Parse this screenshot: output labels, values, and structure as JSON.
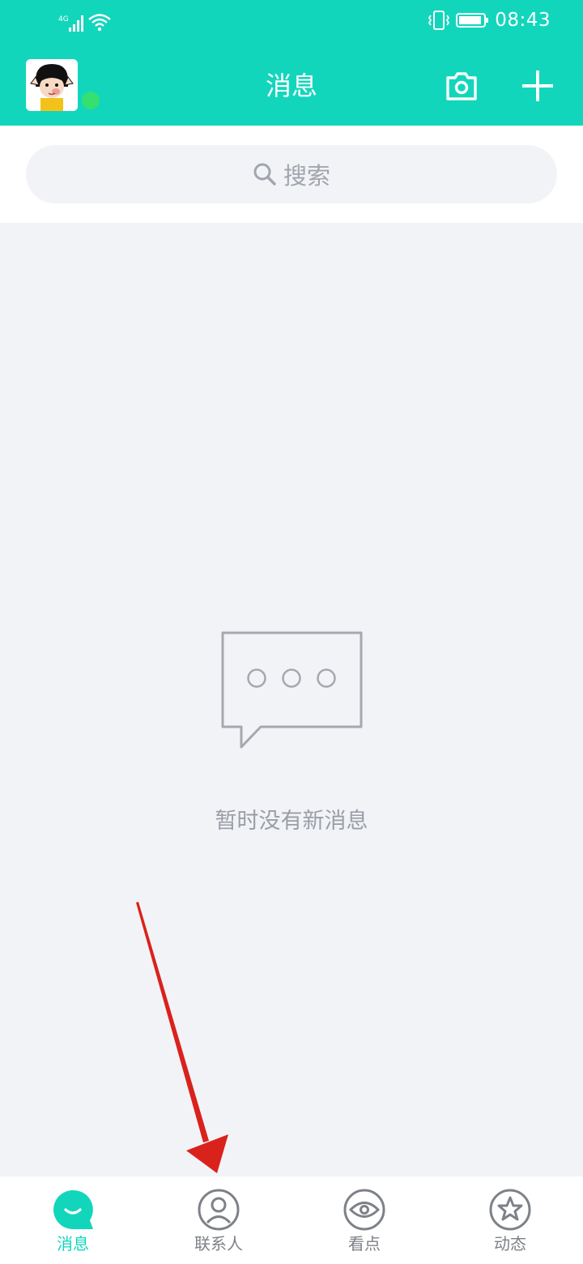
{
  "status_bar": {
    "network": "4G",
    "time": "08:43"
  },
  "header": {
    "title": "消息",
    "icons": [
      "avatar",
      "camera-icon",
      "plus-icon"
    ]
  },
  "search": {
    "placeholder": "搜索"
  },
  "empty_state": {
    "message": "暂时没有新消息",
    "icon": "chat-bubble-icon"
  },
  "tabbar": {
    "tabs": [
      {
        "label": "消息",
        "icon": "message-icon",
        "active": true
      },
      {
        "label": "联系人",
        "icon": "contacts-icon",
        "active": false
      },
      {
        "label": "看点",
        "icon": "eye-icon",
        "active": false
      },
      {
        "label": "动态",
        "icon": "star-icon",
        "active": false
      }
    ]
  },
  "colors": {
    "accent": "#12d6bc",
    "background": "#f2f3f7",
    "annotation_arrow": "#d9221c"
  }
}
